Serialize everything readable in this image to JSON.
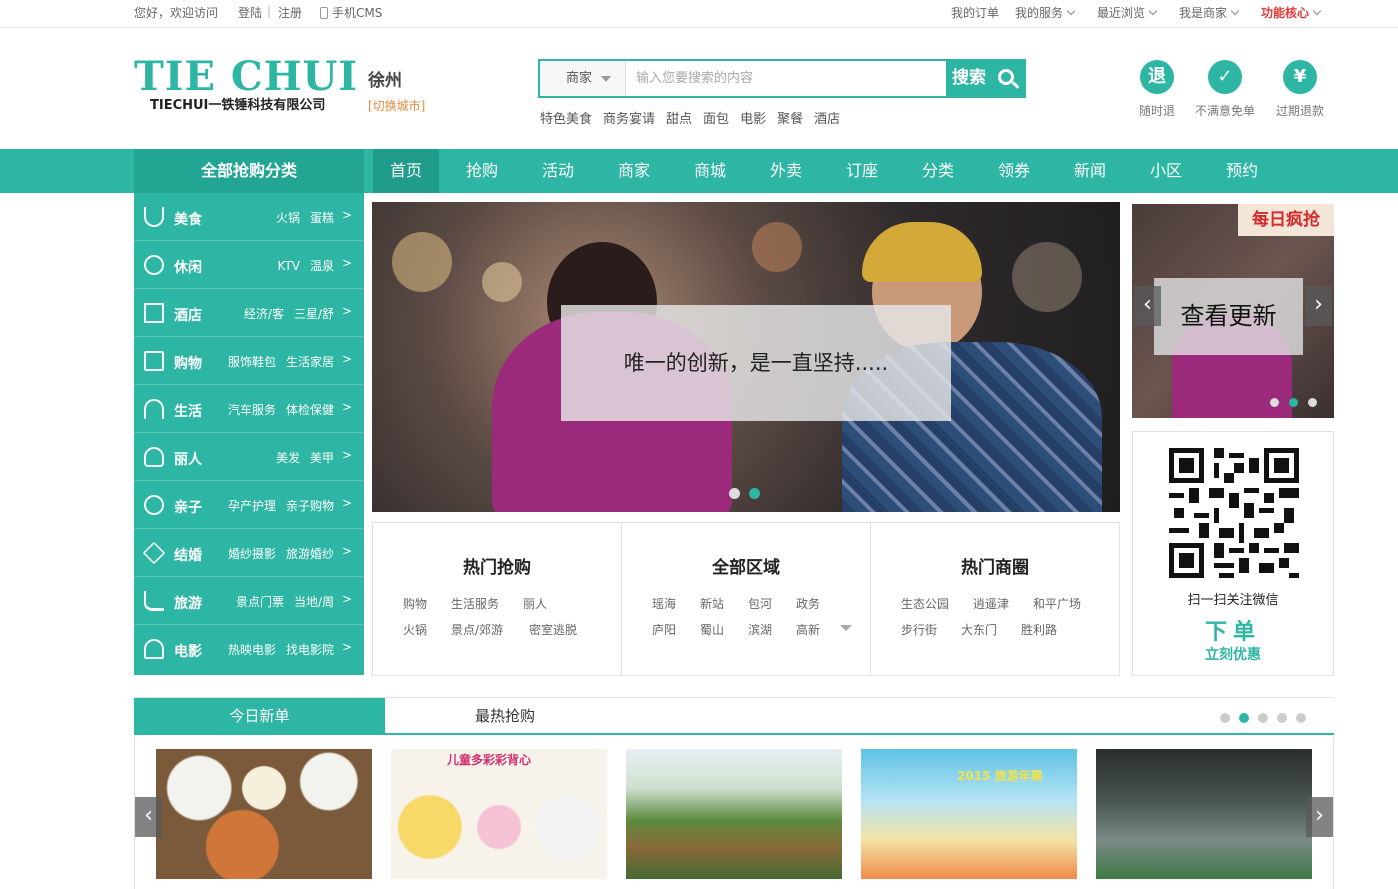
{
  "topbar": {
    "welcome": "您好，欢迎访问",
    "login": "登陆",
    "sep": "|",
    "register": "注册",
    "mobile": "手机CMS",
    "my_orders": "我的订单",
    "my_service": "我的服务",
    "recent": "最近浏览",
    "merchant": "我是商家",
    "core": "功能核心"
  },
  "logo": {
    "main": "TIE CHUI",
    "sub": "TIECHUI一铁锤科技有限公司"
  },
  "city": {
    "name": "徐州",
    "switch": "[切换城市]"
  },
  "search": {
    "type": "商家",
    "placeholder": "输入您要搜索的内容",
    "button": "搜索",
    "hot_words": [
      "特色美食",
      "商务宴请",
      "甜点",
      "面包",
      "电影",
      "聚餐",
      "酒店"
    ]
  },
  "badges": [
    {
      "symbol": "退",
      "label": "随时退"
    },
    {
      "symbol": "✓",
      "label": "不满意免单"
    },
    {
      "symbol": "¥",
      "label": "过期退款"
    }
  ],
  "nav": {
    "all_label": "全部抢购分类",
    "items": [
      "首页",
      "抢购",
      "活动",
      "商家",
      "商城",
      "外卖",
      "订座",
      "分类",
      "领券",
      "新闻",
      "小区",
      "预约"
    ]
  },
  "categories": [
    {
      "name": "美食",
      "subs": [
        "火锅",
        "蛋糕"
      ],
      "icon": "bowl-icon"
    },
    {
      "name": "休闲",
      "subs": [
        "KTV",
        "温泉"
      ],
      "icon": "leisure-icon"
    },
    {
      "name": "酒店",
      "subs": [
        "经济/客",
        "三星/舒"
      ],
      "icon": "hotel-icon"
    },
    {
      "name": "购物",
      "subs": [
        "服饰鞋包",
        "生活家居"
      ],
      "icon": "bag-icon"
    },
    {
      "name": "生活",
      "subs": [
        "汽车服务",
        "体检保健"
      ],
      "icon": "umbrella-icon"
    },
    {
      "name": "丽人",
      "subs": [
        "美发",
        "美甲"
      ],
      "icon": "beauty-icon"
    },
    {
      "name": "亲子",
      "subs": [
        "孕产护理",
        "亲子购物"
      ],
      "icon": "kids-icon"
    },
    {
      "name": "结婚",
      "subs": [
        "婚纱摄影",
        "旅游婚纱"
      ],
      "icon": "diamond-icon"
    },
    {
      "name": "旅游",
      "subs": [
        "景点门票",
        "当地/周"
      ],
      "icon": "palm-icon"
    },
    {
      "name": "电影",
      "subs": [
        "热映电影",
        "找电影院"
      ],
      "icon": "film-icon"
    }
  ],
  "cat_arrow": ">",
  "banner": {
    "caption": "唯一的创新，是一直坚持....."
  },
  "promo": {
    "tag": "每日疯抢",
    "card": "查看更新",
    "prev": "‹",
    "next": "›"
  },
  "qr": {
    "text": "扫一扫关注微信",
    "go": "下单",
    "deal": "立刻优惠"
  },
  "hot_buy": {
    "title": "热门抢购",
    "links": [
      "购物",
      "生活服务",
      "丽人",
      "火锅",
      "景点/郊游",
      "密室逃脱"
    ]
  },
  "areas": {
    "title": "全部区域",
    "links": [
      "瑶海",
      "新站",
      "包河",
      "政务",
      "庐阳",
      "蜀山",
      "滨湖",
      "高新"
    ]
  },
  "hot_circle": {
    "title": "热门商圈",
    "links": [
      "生态公园",
      "逍遥津",
      "和平广场",
      "步行街",
      "大东门",
      "胜利路"
    ]
  },
  "tabs": {
    "today": "今日新单",
    "hot": "最热抢购"
  },
  "thumbs": {
    "t2_label": "儿童多彩彩背心",
    "t4_label": "2015 旅游年票"
  },
  "colors": {
    "accent": "#2db6a3",
    "accent_dark": "#1f9c8a",
    "highlight": "#e4393c",
    "switch_city": "#e98a3c"
  }
}
